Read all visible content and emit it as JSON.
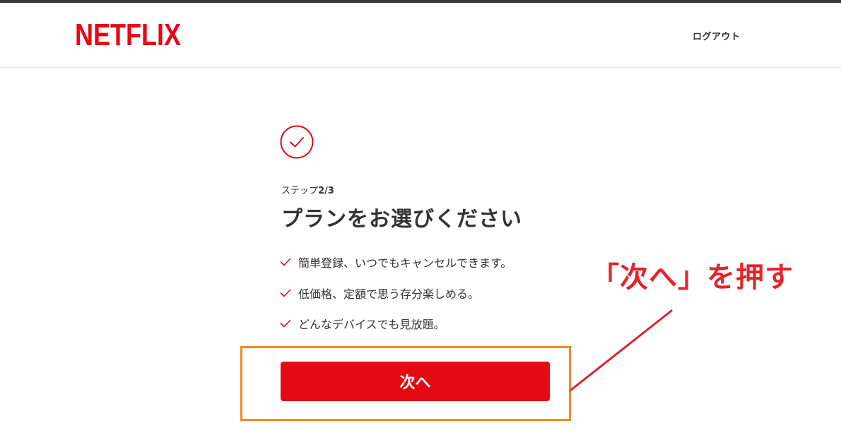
{
  "header": {
    "logo_text": "NETFLIX",
    "logout_label": "ログアウト"
  },
  "main": {
    "step_prefix": "ステップ",
    "step_number": "2/3",
    "title": "プランをお選びください",
    "benefits": [
      "簡単登録、いつでもキャンセルできます。",
      "低価格、定額で思う存分楽しめる。",
      "どんなデバイスでも見放題。"
    ],
    "next_button_label": "次へ"
  },
  "annotation": {
    "text": "「次へ」を押す"
  },
  "colors": {
    "brand_red": "#e50914",
    "highlight_orange": "#f08a24",
    "annotation_red": "#e5232b"
  },
  "icons": {
    "check_circle": "check-circle-icon",
    "checkmark": "checkmark-icon"
  }
}
